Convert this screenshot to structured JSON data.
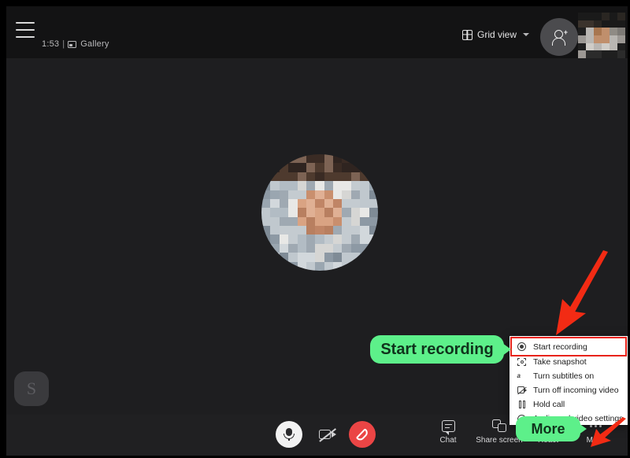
{
  "app": {
    "name": "Skype call window",
    "theme_bg": "#1e1e20",
    "accent_green": "#5df08a",
    "accent_red": "#e8231a",
    "end_call_red": "#eb4545"
  },
  "header": {
    "menu_icon": "hamburger-icon",
    "call_timer": "1:53",
    "separator": "|",
    "gallery_icon": "gallery-icon",
    "gallery_label": "Gallery",
    "grid_view": {
      "icon": "grid-icon",
      "label": "Grid view",
      "chevron": "chevron-down-icon"
    },
    "add_person": {
      "icon": "add-person-icon",
      "label": ""
    },
    "self_thumbnail": "pixelated-self-video-thumbnail"
  },
  "stage": {
    "main_participant_avatar": "pixelated-participant-avatar",
    "skype_badge_letter": "S"
  },
  "toolbar": {
    "mic": {
      "icon": "microphone-icon",
      "label": ""
    },
    "camera": {
      "icon": "camera-off-icon",
      "label": ""
    },
    "end_call": {
      "icon": "end-call-icon",
      "label": ""
    },
    "items": [
      {
        "icon": "chat-icon",
        "label": "Chat"
      },
      {
        "icon": "share-screen-icon",
        "label": "Share screen"
      },
      {
        "icon": "react-icon",
        "label": "React"
      },
      {
        "icon": "more-icon",
        "label": "More"
      }
    ]
  },
  "context_menu": {
    "items": [
      {
        "icon": "record-icon",
        "label": "Start recording",
        "highlighted": true
      },
      {
        "icon": "snapshot-icon",
        "label": "Take snapshot",
        "highlighted": false
      },
      {
        "icon": "subtitles-icon",
        "label": "Turn subtitles on",
        "highlighted": false
      },
      {
        "icon": "incoming-video-icon",
        "label": "Turn off incoming video",
        "highlighted": false
      },
      {
        "icon": "hold-call-icon",
        "label": "Hold call",
        "highlighted": false
      },
      {
        "icon": "settings-icon",
        "label": "Audio and video settings",
        "highlighted": false
      }
    ]
  },
  "annotations": {
    "callout_start_recording": "Start recording",
    "callout_more": "More",
    "arrow_to_menu_item": "red-arrow-icon",
    "arrow_to_more_button": "red-arrow-icon"
  }
}
